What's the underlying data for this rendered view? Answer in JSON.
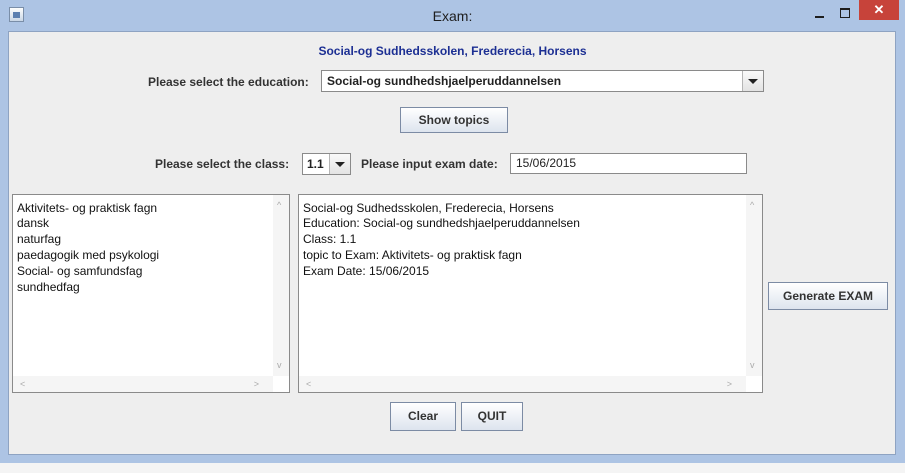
{
  "window": {
    "title": "Exam:",
    "close_glyph": "✕"
  },
  "header": {
    "school": "Social-og Sudhedsskolen, Frederecia, Horsens"
  },
  "education": {
    "label": "Please select the education:",
    "selected": "Social-og sundhedshjaelperuddannelsen"
  },
  "show_topics_label": "Show topics",
  "class_select": {
    "label": "Please select the class:",
    "selected": "1.1"
  },
  "exam_date": {
    "label": "Please input exam date:",
    "value": "15/06/2015"
  },
  "topics": [
    "Aktivitets- og praktisk fagn",
    "dansk",
    "naturfag",
    "paedagogik med psykologi",
    "Social- og samfundsfag",
    "sundhedfag"
  ],
  "output_lines": [
    "Social-og Sudhedsskolen, Frederecia, Horsens",
    " Education: Social-og sundhedshjaelperuddannelsen",
    " Class: 1.1",
    " topic to Exam: Aktivitets- og praktisk fagn",
    " Exam Date: 15/06/2015"
  ],
  "generate_label": "Generate EXAM",
  "clear_label": "Clear",
  "quit_label": "QUIT",
  "scroll_glyphs": {
    "up": "^",
    "down": "v",
    "left": "<",
    "right": ">"
  }
}
